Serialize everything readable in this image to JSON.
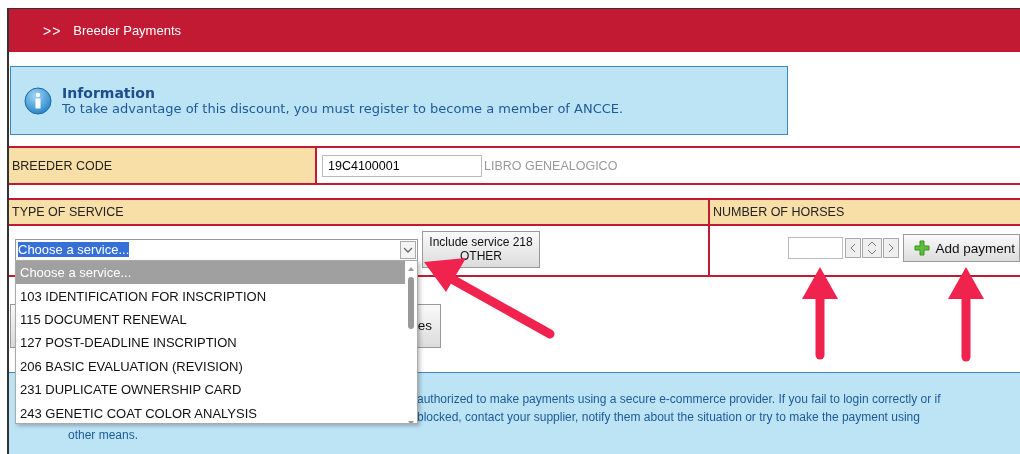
{
  "header": {
    "marker": ">>",
    "title": "Breeder Payments"
  },
  "info": {
    "title": "Information",
    "message": "To take advantage of this discount, you must register to become a member of ANCCE."
  },
  "breeder_code": {
    "label": "BREEDER CODE",
    "value": "19C4100001",
    "note": "LIBRO GENEALOGICO"
  },
  "service": {
    "heading": "TYPE OF SERVICE",
    "select_value": "Choose a service...",
    "expanded": true,
    "include_button": [
      "Include service 218",
      "OTHER"
    ],
    "options": [
      {
        "label": "Choose a service...",
        "selected": true
      },
      {
        "label": "103 IDENTIFICATION FOR INSCRIPTION",
        "selected": false
      },
      {
        "label": "115 DOCUMENT RENEWAL",
        "selected": false
      },
      {
        "label": "127 POST-DEADLINE INSCRIPTION",
        "selected": false
      },
      {
        "label": "206 BASIC EVALUATION (REVISION)",
        "selected": false
      },
      {
        "label": "231 DUPLICATE OWNERSHIP CARD",
        "selected": false
      },
      {
        "label": "243 GENETIC COAT COLOR ANALYSIS",
        "selected": false
      }
    ]
  },
  "horses": {
    "heading": "NUMBER OF HORSES",
    "add_button": "Add payment"
  },
  "partial_button": "es",
  "notice_lines": [
    "authorized to make payments using a secure e-commerce provider. If you fail to login correctly or if",
    "blocked, contact your supplier, notify them about the situation or try to make the payment using",
    "other means."
  ]
}
